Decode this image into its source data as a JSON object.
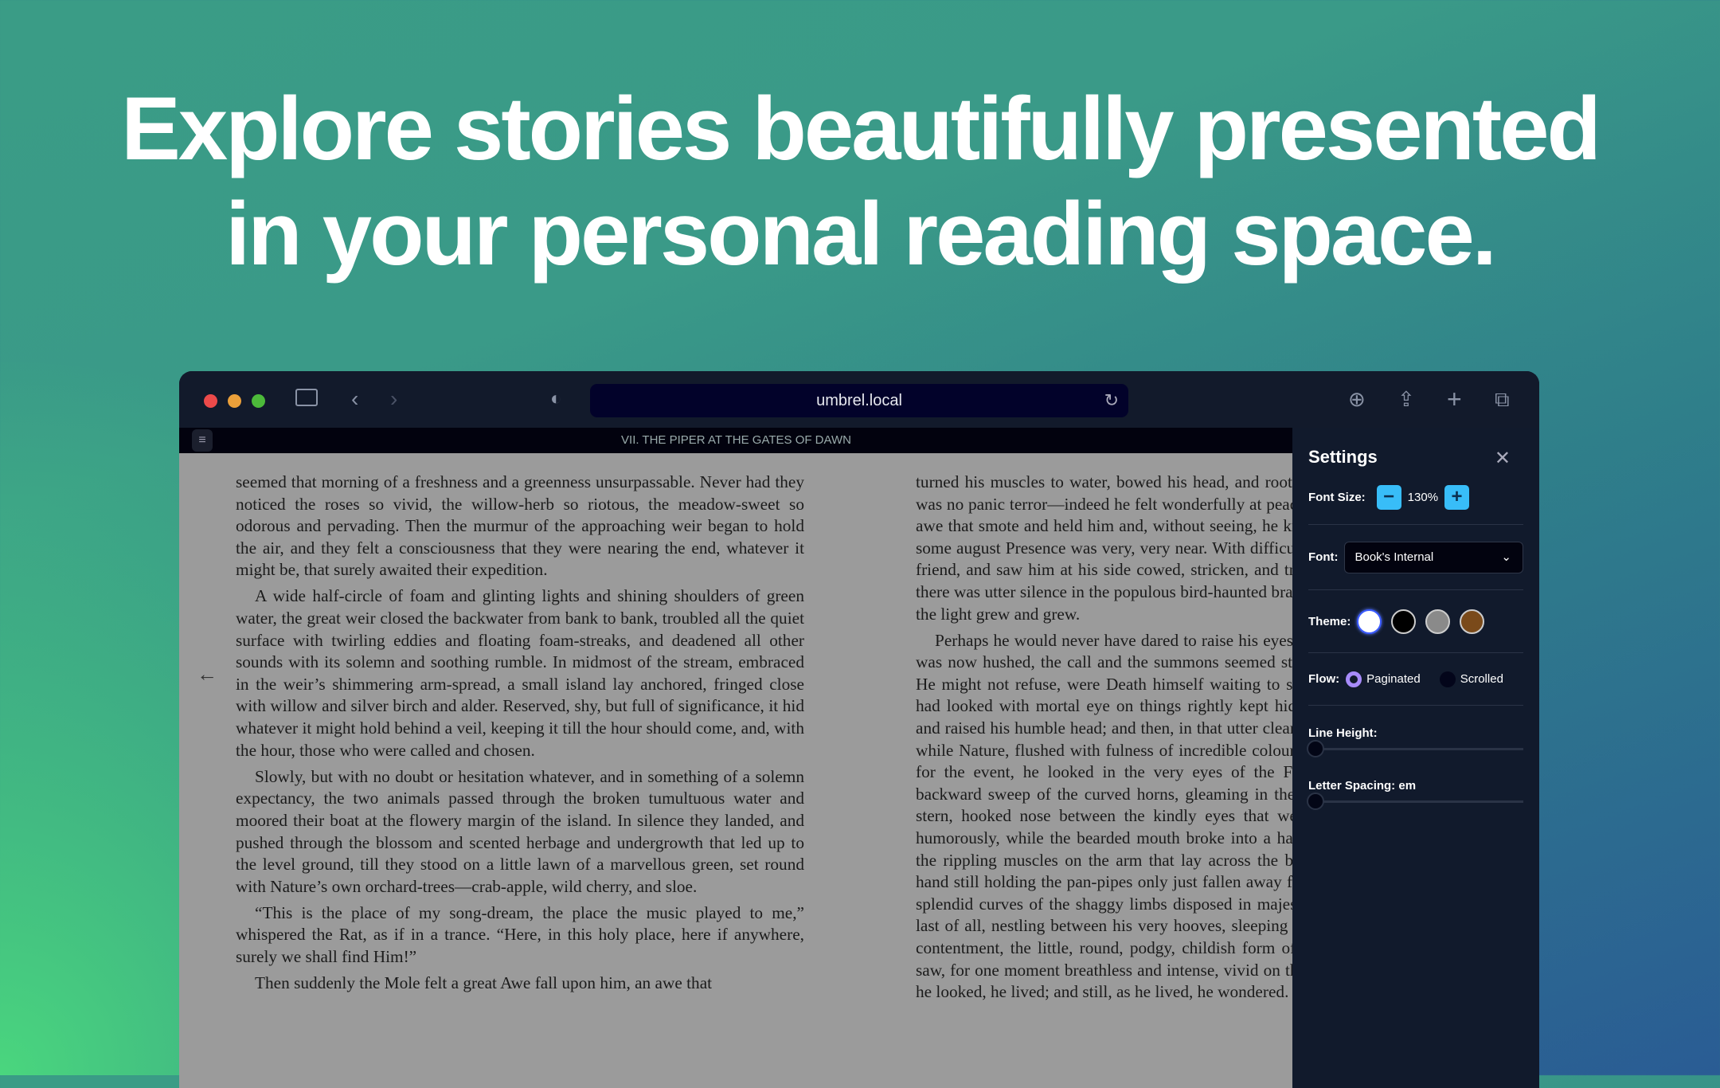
{
  "headline": {
    "line1": "Explore stories beautifully presented",
    "line2": "in your personal reading space."
  },
  "browser": {
    "url": "umbrel.local"
  },
  "reader": {
    "chapter_title": "VII. THE PIPER AT THE GATES OF DAWN",
    "left_paragraphs": [
      "seemed that morning of a freshness and a greenness unsurpassable. Never had they noticed the roses so vivid, the willow-herb so riotous, the meadow-sweet so odorous and pervading. Then the murmur of the approaching weir began to hold the air, and they felt a consciousness that they were nearing the end, whatever it might be, that surely awaited their expedition.",
      "A wide half-circle of foam and glinting lights and shining shoulders of green water, the great weir closed the backwater from bank to bank, troubled all the quiet surface with twirling eddies and floating foam-streaks, and deadened all other sounds with its solemn and soothing rumble. In midmost of the stream, embraced in the weir’s shimmering arm-spread, a small island lay anchored, fringed close with willow and silver birch and alder. Reserved, shy, but full of significance, it hid whatever it might hold behind a veil, keeping it till the hour should come, and, with the hour, those who were called and chosen.",
      "Slowly, but with no doubt or hesitation whatever, and in something of a solemn expectancy, the two animals passed through the broken tumultuous water and moored their boat at the flowery margin of the island. In silence they landed, and pushed through the blossom and scented herbage and undergrowth that led up to the level ground, till they stood on a little lawn of a marvellous green, set round with Nature’s own orchard-trees—crab-apple, wild cherry, and sloe.",
      "“This is the place of my song-dream, the place the music played to me,” whispered the Rat, as if in a trance. “Here, in this holy place, here if anywhere, surely we shall find Him!”",
      "Then suddenly the Mole felt a great Awe fall upon him, an awe that"
    ],
    "right_paragraphs": [
      "turned his muscles to water, bowed his head, and rooted his feet to the ground. It was no panic terror—indeed he felt wonderfully at peace and happy—but it was an awe that smote and held him and, without seeing, he knew it could only mean that some august Presence was very, very near. With difficulty he turned to look for his friend, and saw him at his side cowed, stricken, and trembling violently. And still there was utter silence in the populous bird-haunted branches around them; and still the light grew and grew.",
      "Perhaps he would never have dared to raise his eyes, but that, though the piping was now hushed, the call and the summons seemed still dominant and imperious. He might not refuse, were Death himself waiting to strike him instantly, once he had looked with mortal eye on things rightly kept hidden. Trembling he obeyed, and raised his humble head; and then, in that utter clearness of the imminent dawn, while Nature, flushed with fulness of incredible colour, seemed to hold her breath for the event, he looked in the very eyes of the Friend and Helper; saw the backward sweep of the curved horns, gleaming in the growing daylight; saw the stern, hooked nose between the kindly eyes that were looking down on them humorously, while the bearded mouth broke into a half-smile at the corners; saw the rippling muscles on the arm that lay across the broad chest, the long supple hand still holding the pan-pipes only just fallen away from the parted lips; saw the splendid curves of the shaggy limbs disposed in majestic ease on the sward; saw, last of all, nestling between his very hooves, sleeping soundly in entire peace and contentment, the little, round, podgy, childish form of the baby otter. All this he saw, for one moment breathless and intense, vivid on the morning sky; and still, as he looked, he lived; and still, as he lived, he wondered."
    ]
  },
  "settings": {
    "title": "Settings",
    "font_size_label": "Font Size:",
    "font_size_value": "130%",
    "font_label": "Font:",
    "font_value": "Book's Internal",
    "theme_label": "Theme:",
    "themes": [
      "#ffffff",
      "#000000",
      "#8a8a8a",
      "#7a4a1a"
    ],
    "selected_theme": "#ffffff",
    "flow_label": "Flow:",
    "flow_options": [
      "Paginated",
      "Scrolled"
    ],
    "flow_selected": "Paginated",
    "line_height_label": "Line Height:",
    "line_height_value": 0,
    "letter_spacing_label": "Letter Spacing: em",
    "letter_spacing_value": 0
  }
}
